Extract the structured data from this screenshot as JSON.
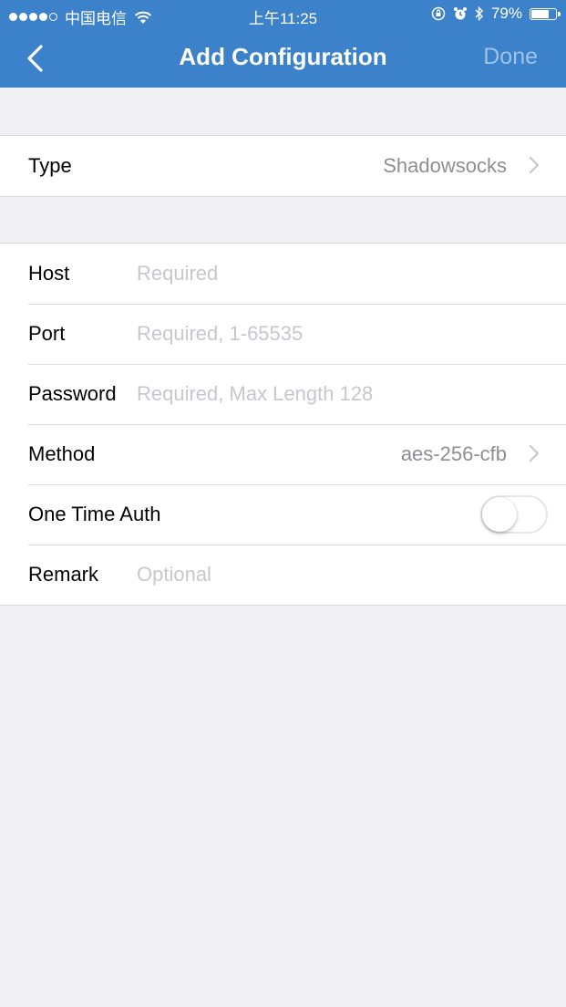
{
  "status_bar": {
    "carrier": "中国电信",
    "time": "上午11:25",
    "battery_percent": "79%",
    "battery_level": 0.79
  },
  "nav": {
    "title": "Add Configuration",
    "done_label": "Done"
  },
  "type_row": {
    "label": "Type",
    "value": "Shadowsocks"
  },
  "form": {
    "host": {
      "label": "Host",
      "placeholder": "Required",
      "value": ""
    },
    "port": {
      "label": "Port",
      "placeholder": "Required, 1-65535",
      "value": ""
    },
    "password": {
      "label": "Password",
      "placeholder": "Required, Max Length 128",
      "value": ""
    },
    "method": {
      "label": "Method",
      "value": "aes-256-cfb"
    },
    "one_time_auth": {
      "label": "One Time Auth",
      "enabled": false
    },
    "remark": {
      "label": "Remark",
      "placeholder": "Optional",
      "value": ""
    }
  },
  "colors": {
    "nav_background": "#3c82ca",
    "page_background": "#efeff4",
    "done_disabled": "#9fc2e8",
    "placeholder": "#c7c7cd",
    "secondary_text": "#8e8e93"
  },
  "icons": [
    "signal-dots-icon",
    "wifi-icon",
    "orientation-lock-icon",
    "alarm-icon",
    "bluetooth-icon",
    "battery-icon",
    "back-chevron-icon",
    "chevron-right-icon"
  ]
}
